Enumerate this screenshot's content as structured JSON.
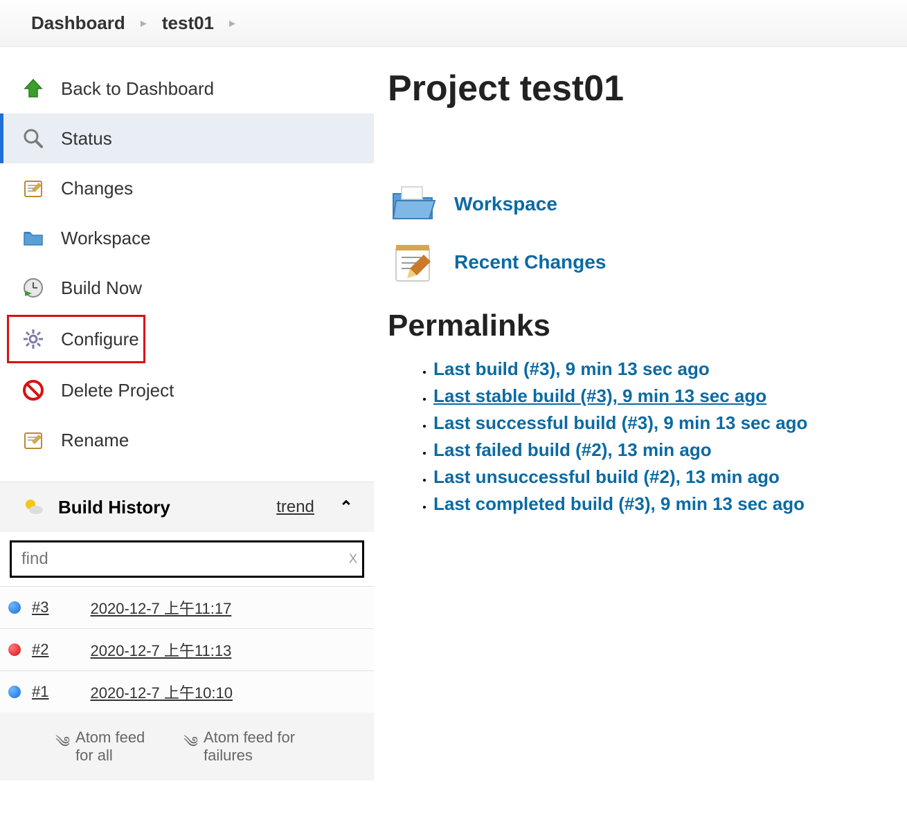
{
  "breadcrumb": {
    "root": "Dashboard",
    "project": "test01"
  },
  "sidebar": {
    "items": [
      {
        "id": "back-to-dashboard",
        "label": "Back to Dashboard"
      },
      {
        "id": "status",
        "label": "Status"
      },
      {
        "id": "changes",
        "label": "Changes"
      },
      {
        "id": "workspace",
        "label": "Workspace"
      },
      {
        "id": "build-now",
        "label": "Build Now"
      },
      {
        "id": "configure",
        "label": "Configure"
      },
      {
        "id": "delete-project",
        "label": "Delete Project"
      },
      {
        "id": "rename",
        "label": "Rename"
      }
    ]
  },
  "build_history": {
    "title": "Build History",
    "trend_label": "trend",
    "find_placeholder": "find",
    "builds": [
      {
        "number": "#3",
        "status": "blue",
        "timestamp": "2020-12-7 上午11:17"
      },
      {
        "number": "#2",
        "status": "red",
        "timestamp": "2020-12-7 上午11:13"
      },
      {
        "number": "#1",
        "status": "blue",
        "timestamp": "2020-12-7 上午10:10"
      }
    ],
    "feeds": {
      "all": "Atom feed for all",
      "failures": "Atom feed for failures"
    }
  },
  "main": {
    "title": "Project test01",
    "links": {
      "workspace": "Workspace",
      "recent_changes": "Recent Changes"
    },
    "permalinks_title": "Permalinks",
    "permalinks": [
      {
        "text": "Last build (#3), 9 min 13 sec ago",
        "hovered": false
      },
      {
        "text": "Last stable build (#3), 9 min 13 sec ago",
        "hovered": true
      },
      {
        "text": "Last successful build (#3), 9 min 13 sec ago",
        "hovered": false
      },
      {
        "text": "Last failed build (#2), 13 min ago",
        "hovered": false
      },
      {
        "text": "Last unsuccessful build (#2), 13 min ago",
        "hovered": false
      },
      {
        "text": "Last completed build (#3), 9 min 13 sec ago",
        "hovered": false
      }
    ]
  }
}
